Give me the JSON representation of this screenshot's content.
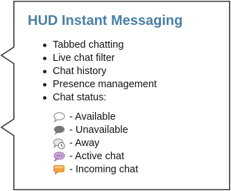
{
  "title": "HUD Instant Messaging",
  "features": [
    "Tabbed chatting",
    "Live chat filter",
    "Chat history",
    "Presence management",
    "Chat status:"
  ],
  "statuses": [
    {
      "icon": "speech-bubble-outline-icon",
      "label": "- Available"
    },
    {
      "icon": "speech-bubble-gray-icon",
      "label": "- Unavailable"
    },
    {
      "icon": "speech-bubble-clock-icon",
      "label": "- Away"
    },
    {
      "icon": "speech-bubble-purple-icon",
      "label": "- Active chat"
    },
    {
      "icon": "speech-bubble-orange-icon",
      "label": "- Incoming chat"
    }
  ],
  "colors": {
    "title": "#4a7fa8",
    "border": "#333333",
    "active": "#c9a6d8",
    "incoming": "#f0a040",
    "unavailable": "#777777"
  }
}
